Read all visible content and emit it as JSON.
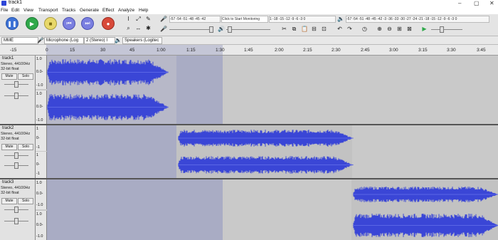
{
  "window": {
    "title": "track1"
  },
  "menu": [
    "File",
    "Edit",
    "View",
    "Transport",
    "Tracks",
    "Generate",
    "Effect",
    "Analyze",
    "Help"
  ],
  "transport": {
    "icons": [
      "pause-icon",
      "play-icon",
      "stop-icon",
      "skip-start-icon",
      "skip-end-icon",
      "record-icon"
    ]
  },
  "meters": {
    "record_scale": "-57 -54 -51 -48 -45 -42",
    "record_hint": "Click to Start Monitoring",
    "record_scale2": "1 -18 -15 -12 -9 -6 -3 0",
    "play_scale": "-57 -54 -51 -48 -45 -42 -3 -36 -33 -30 -27 -24 -21 -18 -15 -12 -9 -6 -3 0"
  },
  "devices": {
    "host": "MME",
    "input": "Microphone (Log",
    "channels": "2 (Stereo) I",
    "output": "Speakers (Logitec"
  },
  "timeline": {
    "ticks": [
      "-15",
      "0",
      "15",
      "30",
      "45",
      "1:00",
      "1:15",
      "1:30",
      "1:45",
      "2:00",
      "2:15",
      "2:30",
      "2:45",
      "3:00",
      "3:15",
      "3:30",
      "3:45"
    ]
  },
  "tracks": [
    {
      "name": "track1",
      "format": "Stereo, 44100Hz",
      "bits": "32-bit float",
      "mute": "Mute",
      "solo": "Solo",
      "scale_top": "1.0",
      "scale_mid": "0.0-",
      "scale_bot": "-1.0",
      "scale2_top": "1.0",
      "scale2_mid": "0.0-",
      "scale2_bot": "-1.0"
    },
    {
      "name": "track2",
      "format": "Stereo, 44100Hz",
      "bits": "32-bit float",
      "mute": "Mute",
      "solo": "Solo",
      "scale_top": "1",
      "scale_mid": "0-",
      "scale_bot": "-1",
      "scale2_top": "1",
      "scale2_mid": "0-",
      "scale2_bot": "-1"
    },
    {
      "name": "track3",
      "format": "Stereo, 44100Hz",
      "bits": "32-bit float",
      "mute": "Mute",
      "solo": "Solo",
      "scale_top": "1.0",
      "scale_mid": "0.0-",
      "scale_bot": "-1.0",
      "scale2_top": "1.0",
      "scale2_mid": "0.0-",
      "scale2_bot": "-1.0"
    }
  ],
  "colors": {
    "wave": "#3a46d6",
    "selection": "#a9acc4",
    "track_bg": "#c9c9c9"
  }
}
